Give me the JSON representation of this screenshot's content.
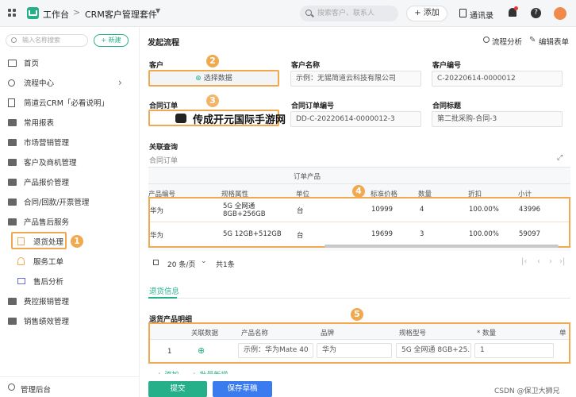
{
  "topbar": {
    "workspace": "工作台",
    "breadcrumb_sep": ">",
    "app_title": "CRM客户管理套件",
    "search_placeholder": "搜索客户、联系人",
    "add_label": "+ 添加",
    "contacts_label": "通讯录"
  },
  "sidebar": {
    "search_placeholder": "输入名称搜索",
    "new_label": "+ 新建",
    "items": [
      {
        "label": "首页"
      },
      {
        "label": "流程中心"
      },
      {
        "label": "简道云CRM「必看说明」"
      },
      {
        "label": "常用报表"
      },
      {
        "label": "市场营销管理"
      },
      {
        "label": "客户及商机管理"
      },
      {
        "label": "产品报价管理"
      },
      {
        "label": "合同/回款/开票管理"
      },
      {
        "label": "产品售后服务"
      },
      {
        "label": "退货处理"
      },
      {
        "label": "服务工单"
      },
      {
        "label": "售后分析"
      },
      {
        "label": "费控报销管理"
      },
      {
        "label": "销售绩效管理"
      }
    ],
    "footer": "管理后台"
  },
  "main": {
    "title": "发起流程",
    "flow_analysis": "流程分析",
    "edit_form": "编辑表单",
    "customer_label": "客户",
    "select_data": "选择数据",
    "customer_name_label": "客户名称",
    "customer_name_value": "示例：无锡简道云科技有限公司",
    "customer_no_label": "客户编号",
    "customer_no_value": "C-20220614-0000012",
    "contract_label": "合同订单",
    "contract_no_label": "合同订单编号",
    "contract_no_value": "DD-C-20220614-0000012-3",
    "contract_title_label": "合同标题",
    "contract_title_value": "第二批采购-合同-3",
    "related_query": "关联查询",
    "contract_order": "合同订单",
    "watermark": "传成开元国际手游网",
    "group_header": "订单产品",
    "table_headers": [
      "产品编号",
      "规格属性",
      "单位",
      "标准价格",
      "数量",
      "折扣",
      "小计"
    ],
    "rows": [
      {
        "code": "华为",
        "spec1": "5G 全网通",
        "spec2": "8GB+256GB",
        "unit": "台",
        "price": "10999",
        "qty": "4",
        "discount": "100.00%",
        "subtotal": "43996"
      },
      {
        "code": "华为",
        "spec1": "5G 12GB+512GB",
        "spec2": "",
        "unit": "台",
        "price": "19699",
        "qty": "3",
        "discount": "100.00%",
        "subtotal": "59097"
      }
    ],
    "page_size": "20 条/页",
    "total": "共1条",
    "tab_return": "退货信息",
    "return_detail_label": "退货产品明细",
    "return_headers": [
      "关联数据",
      "产品名称",
      "品牌",
      "规格型号",
      "* 数量",
      "单"
    ],
    "return_row": {
      "index": "1",
      "name": "示例：华为Mate 40",
      "brand": "华为",
      "spec": "5G 全网通 8GB+25...",
      "qty": "1"
    },
    "add_link": "+ 添加",
    "batch_link": "+ 批量新增",
    "submit": "提交",
    "save_draft": "保存草稿",
    "credit": "CSDN @保卫大狮兄"
  },
  "markers": [
    "1",
    "2",
    "3",
    "4",
    "5"
  ],
  "colors": {
    "accent": "#26b08a",
    "submit": "#26b08a",
    "draft": "#3a7cf0",
    "highlight": "#f0a94e"
  }
}
